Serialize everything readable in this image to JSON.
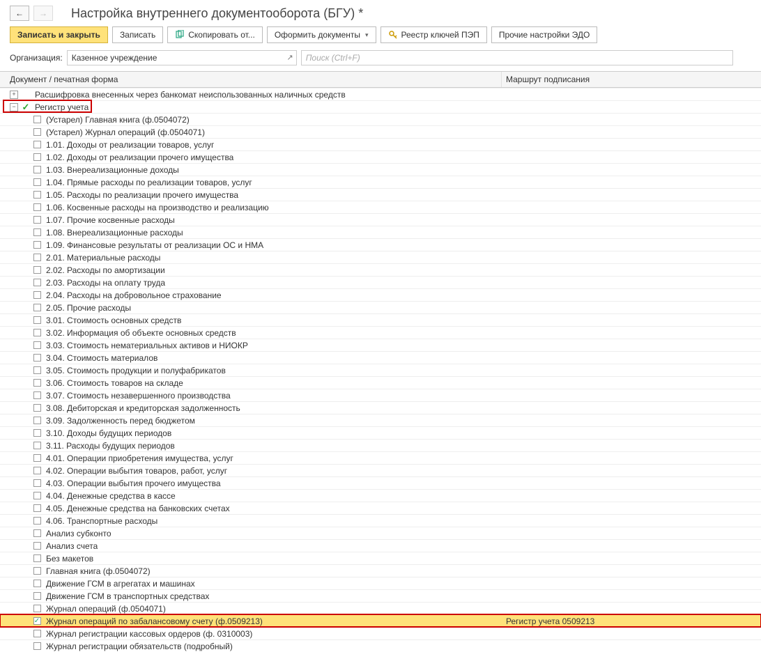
{
  "title": "Настройка внутреннего документооборота (БГУ) *",
  "nav": {
    "back": "←",
    "forward": "→"
  },
  "toolbar": {
    "save_close": "Записать и закрыть",
    "save": "Записать",
    "copy_from": "Скопировать от...",
    "make_docs": "Оформить документы",
    "pep_keys": "Реестр ключей ПЭП",
    "other_edo": "Прочие настройки ЭДО"
  },
  "org_label": "Организация:",
  "org_value": "Казенное учреждение",
  "search_placeholder": "Поиск (Ctrl+F)",
  "headers": {
    "col1": "Документ / печатная форма",
    "col2": "Маршрут подписания"
  },
  "rows": [
    {
      "level": 1,
      "expander": "plus",
      "check": "none",
      "label": "Расшифровка внесенных через банкомат неиспользованных наличных средств",
      "route": ""
    },
    {
      "level": 1,
      "expander": "minus",
      "check": "green",
      "label": "Регистр учета",
      "route": "",
      "hl": "box"
    },
    {
      "level": 2,
      "expander": "",
      "check": "empty",
      "label": "(Устарел) Главная книга (ф.0504072)",
      "route": ""
    },
    {
      "level": 2,
      "expander": "",
      "check": "empty",
      "label": "(Устарел) Журнал операций (ф.0504071)",
      "route": ""
    },
    {
      "level": 2,
      "expander": "",
      "check": "empty",
      "label": "1.01. Доходы от реализации товаров, услуг",
      "route": ""
    },
    {
      "level": 2,
      "expander": "",
      "check": "empty",
      "label": "1.02. Доходы от реализации прочего имущества",
      "route": ""
    },
    {
      "level": 2,
      "expander": "",
      "check": "empty",
      "label": "1.03. Внереализационные доходы",
      "route": ""
    },
    {
      "level": 2,
      "expander": "",
      "check": "empty",
      "label": "1.04. Прямые расходы по реализации товаров, услуг",
      "route": ""
    },
    {
      "level": 2,
      "expander": "",
      "check": "empty",
      "label": "1.05. Расходы по реализации прочего имущества",
      "route": ""
    },
    {
      "level": 2,
      "expander": "",
      "check": "empty",
      "label": "1.06. Косвенные расходы на производство и реализацию",
      "route": ""
    },
    {
      "level": 2,
      "expander": "",
      "check": "empty",
      "label": "1.07. Прочие косвенные расходы",
      "route": ""
    },
    {
      "level": 2,
      "expander": "",
      "check": "empty",
      "label": "1.08. Внереализационные расходы",
      "route": ""
    },
    {
      "level": 2,
      "expander": "",
      "check": "empty",
      "label": "1.09. Финансовые результаты от реализации ОС и НМА",
      "route": ""
    },
    {
      "level": 2,
      "expander": "",
      "check": "empty",
      "label": "2.01. Материальные расходы",
      "route": ""
    },
    {
      "level": 2,
      "expander": "",
      "check": "empty",
      "label": "2.02. Расходы по амортизации",
      "route": ""
    },
    {
      "level": 2,
      "expander": "",
      "check": "empty",
      "label": "2.03. Расходы на оплату труда",
      "route": ""
    },
    {
      "level": 2,
      "expander": "",
      "check": "empty",
      "label": "2.04. Расходы на добровольное страхование",
      "route": ""
    },
    {
      "level": 2,
      "expander": "",
      "check": "empty",
      "label": "2.05. Прочие расходы",
      "route": ""
    },
    {
      "level": 2,
      "expander": "",
      "check": "empty",
      "label": "3.01. Стоимость основных средств",
      "route": ""
    },
    {
      "level": 2,
      "expander": "",
      "check": "empty",
      "label": "3.02. Информация об объекте основных средств",
      "route": ""
    },
    {
      "level": 2,
      "expander": "",
      "check": "empty",
      "label": "3.03. Стоимость нематериальных активов и НИОКР",
      "route": ""
    },
    {
      "level": 2,
      "expander": "",
      "check": "empty",
      "label": "3.04. Стоимость материалов",
      "route": ""
    },
    {
      "level": 2,
      "expander": "",
      "check": "empty",
      "label": "3.05. Стоимость продукции и полуфабрикатов",
      "route": ""
    },
    {
      "level": 2,
      "expander": "",
      "check": "empty",
      "label": "3.06. Стоимость товаров на складе",
      "route": ""
    },
    {
      "level": 2,
      "expander": "",
      "check": "empty",
      "label": "3.07. Стоимость незавершенного производства",
      "route": ""
    },
    {
      "level": 2,
      "expander": "",
      "check": "empty",
      "label": "3.08. Дебиторская и кредиторская задолженность",
      "route": ""
    },
    {
      "level": 2,
      "expander": "",
      "check": "empty",
      "label": "3.09. Задолженность перед бюджетом",
      "route": ""
    },
    {
      "level": 2,
      "expander": "",
      "check": "empty",
      "label": "3.10. Доходы будущих периодов",
      "route": ""
    },
    {
      "level": 2,
      "expander": "",
      "check": "empty",
      "label": "3.11. Расходы будущих периодов",
      "route": ""
    },
    {
      "level": 2,
      "expander": "",
      "check": "empty",
      "label": "4.01. Операции приобретения имущества, услуг",
      "route": ""
    },
    {
      "level": 2,
      "expander": "",
      "check": "empty",
      "label": "4.02. Операции выбытия товаров, работ, услуг",
      "route": ""
    },
    {
      "level": 2,
      "expander": "",
      "check": "empty",
      "label": "4.03. Операции выбытия прочего имущества",
      "route": ""
    },
    {
      "level": 2,
      "expander": "",
      "check": "empty",
      "label": "4.04. Денежные средства в кассе",
      "route": ""
    },
    {
      "level": 2,
      "expander": "",
      "check": "empty",
      "label": "4.05. Денежные средства на банковских счетах",
      "route": ""
    },
    {
      "level": 2,
      "expander": "",
      "check": "empty",
      "label": "4.06. Транспортные расходы",
      "route": ""
    },
    {
      "level": 2,
      "expander": "",
      "check": "empty",
      "label": "Анализ субконто",
      "route": ""
    },
    {
      "level": 2,
      "expander": "",
      "check": "empty",
      "label": "Анализ счета",
      "route": ""
    },
    {
      "level": 2,
      "expander": "",
      "check": "empty",
      "label": "Без макетов",
      "route": ""
    },
    {
      "level": 2,
      "expander": "",
      "check": "empty",
      "label": "Главная книга (ф.0504072)",
      "route": ""
    },
    {
      "level": 2,
      "expander": "",
      "check": "empty",
      "label": "Движение ГСМ в агрегатах и машинах",
      "route": ""
    },
    {
      "level": 2,
      "expander": "",
      "check": "empty",
      "label": "Движение ГСМ в транспортных средствах",
      "route": ""
    },
    {
      "level": 2,
      "expander": "",
      "check": "empty",
      "label": "Журнал операций (ф.0504071)",
      "route": ""
    },
    {
      "level": 2,
      "expander": "",
      "check": "checked",
      "label": "Журнал операций по забалансовому счету (ф.0509213)",
      "route": "Регистр учета 0509213",
      "hl": "boxsel"
    },
    {
      "level": 2,
      "expander": "",
      "check": "empty",
      "label": "Журнал регистрации кассовых ордеров (ф. 0310003)",
      "route": ""
    },
    {
      "level": 2,
      "expander": "",
      "check": "empty",
      "label": "Журнал регистрации обязательств (подробный)",
      "route": ""
    }
  ]
}
